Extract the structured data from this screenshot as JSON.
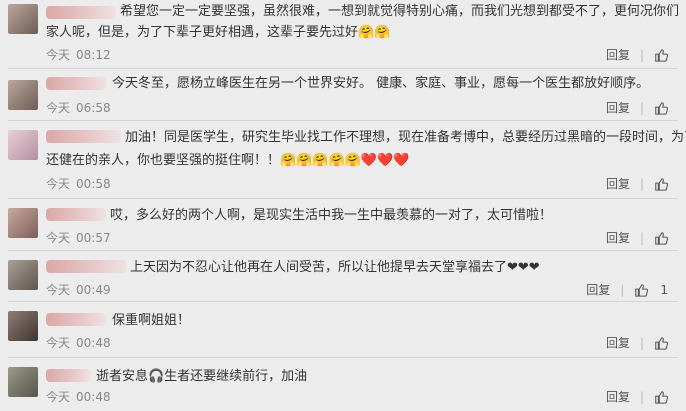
{
  "comments": [
    {
      "text_prefix": "希望您一定一定要坚强，虽然很难，一想到就觉得特别心痛，而我们光想到都受不了，更何况你们",
      "text_line2": "家人呢，但是，为了下辈子更好相遇，这辈子要先过好🤗🤗",
      "day": "今天",
      "time": "08:12",
      "reply": "回复",
      "likes": ""
    },
    {
      "text_prefix": "今天冬至，愿杨立峰医生在另一个世界安好。 健康、家庭、事业，愿每一个医生都放好顺序。",
      "text_line2": "",
      "day": "今天",
      "time": "06:58",
      "reply": "回复",
      "likes": ""
    },
    {
      "text_prefix": "加油！同是医学生，研究生毕业找工作不理想，现在准备考博中，总要经历过黑暗的一段时间，为了",
      "text_line2": "还健在的亲人，你也要坚强的挺住啊！！🤗🤗🤗🤗🤗❤️❤️❤️",
      "day": "今天",
      "time": "00:58",
      "reply": "回复",
      "likes": ""
    },
    {
      "text_prefix": "哎，多么好的两个人啊，是现实生活中我一生中最羡慕的一对了，太可惜啦！",
      "text_line2": "",
      "day": "今天",
      "time": "00:57",
      "reply": "回复",
      "likes": ""
    },
    {
      "text_prefix": "上天因为不忍心让他再在人间受苦，所以让他提早去天堂享福去了❤❤❤",
      "text_line2": "",
      "day": "今天",
      "time": "00:49",
      "reply": "回复",
      "likes": "1"
    },
    {
      "text_prefix": "保重啊姐姐！",
      "text_line2": "",
      "day": "今天",
      "time": "00:48",
      "reply": "回复",
      "likes": ""
    },
    {
      "text_prefix": "逝者安息🎧生者还要继续前行，加油",
      "text_line2": "",
      "day": "今天",
      "time": "00:48",
      "reply": "回复",
      "likes": ""
    }
  ],
  "icons": {
    "like": "thumbs-up-icon"
  },
  "colors": {
    "background": "#ececec",
    "time": "#888888",
    "text": "#333333"
  }
}
